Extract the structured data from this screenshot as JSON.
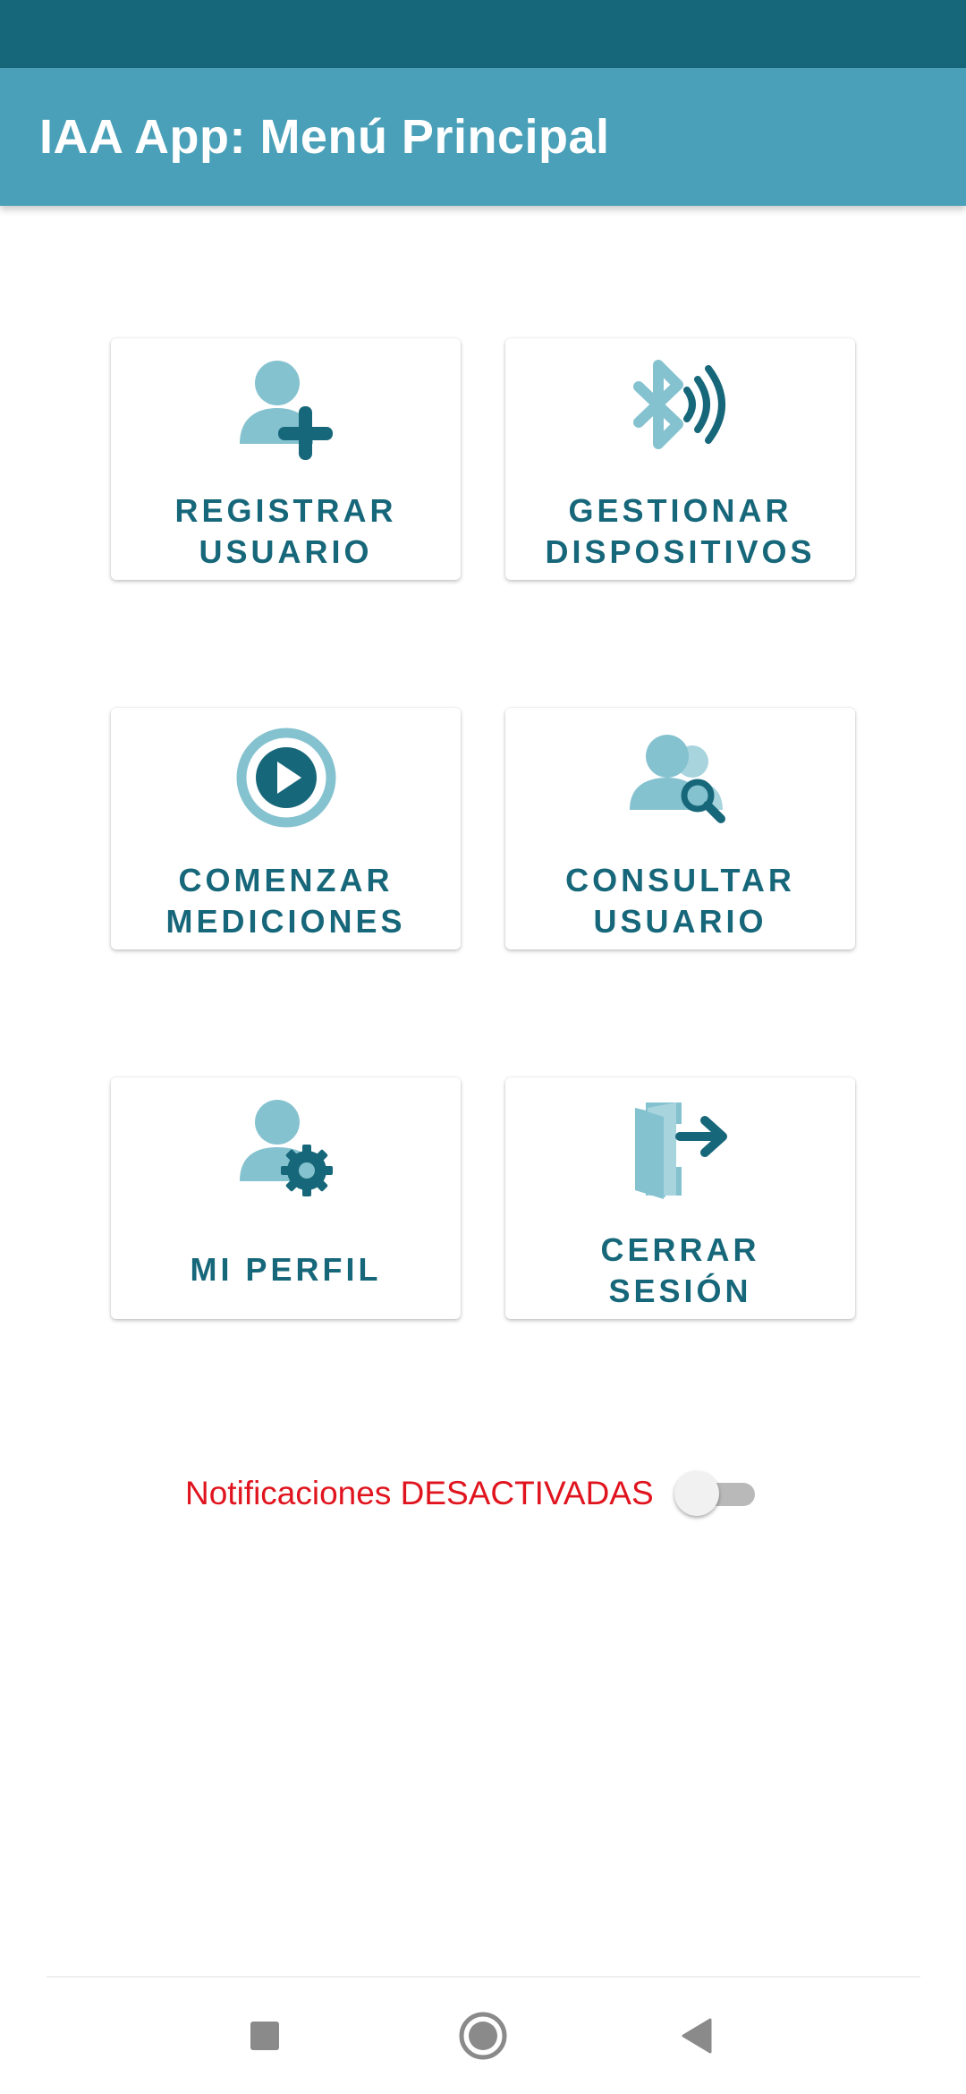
{
  "app_bar": {
    "title": "IAA App: Menú Principal"
  },
  "menu": {
    "items": [
      {
        "label": "REGISTRAR\nUSUARIO",
        "icon": "add-user-icon"
      },
      {
        "label": "GESTIONAR\nDISPOSITIVOS",
        "icon": "bluetooth-signal-icon"
      },
      {
        "label": "COMENZAR\nMEDICIONES",
        "icon": "play-icon"
      },
      {
        "label": "CONSULTAR\nUSUARIO",
        "icon": "user-search-icon"
      },
      {
        "label": "MI PERFIL",
        "icon": "user-settings-icon"
      },
      {
        "label": "CERRAR\nSESIÓN",
        "icon": "logout-icon"
      }
    ]
  },
  "notifications": {
    "label": "Notificaciones DESACTIVADAS",
    "enabled": false
  },
  "system_nav": {
    "recents": "recents-icon",
    "home": "home-icon",
    "back": "back-icon"
  },
  "colors": {
    "status_bar": "#17677a",
    "app_bar": "#4aa0b8",
    "icon_light": "#85c2cf",
    "icon_dark": "#17677a",
    "label": "#17677a",
    "notification_off": "#e0141e"
  }
}
